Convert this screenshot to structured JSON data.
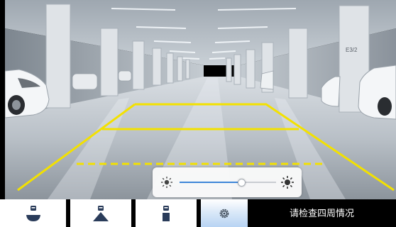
{
  "camera": {
    "pillar_sign": "E3/2"
  },
  "brightness": {
    "level": 0.64,
    "low_icon": "sun-dim-icon",
    "high_icon": "sun-bright-icon"
  },
  "bottom_bar": {
    "buttons": [
      {
        "name": "rear-view-button",
        "icon": "camera-top-view-icon"
      },
      {
        "name": "wide-view-button",
        "icon": "camera-wide-view-icon"
      },
      {
        "name": "ground-view-button",
        "icon": "camera-ground-view-icon"
      },
      {
        "name": "settings-button",
        "icon": "gear-icon",
        "active": true
      }
    ],
    "status_text": "请检查四周情况"
  },
  "colors": {
    "guide_line": "#f3e100",
    "active_button": "#b8d4f3",
    "slider_fill": "#3d86d8"
  }
}
